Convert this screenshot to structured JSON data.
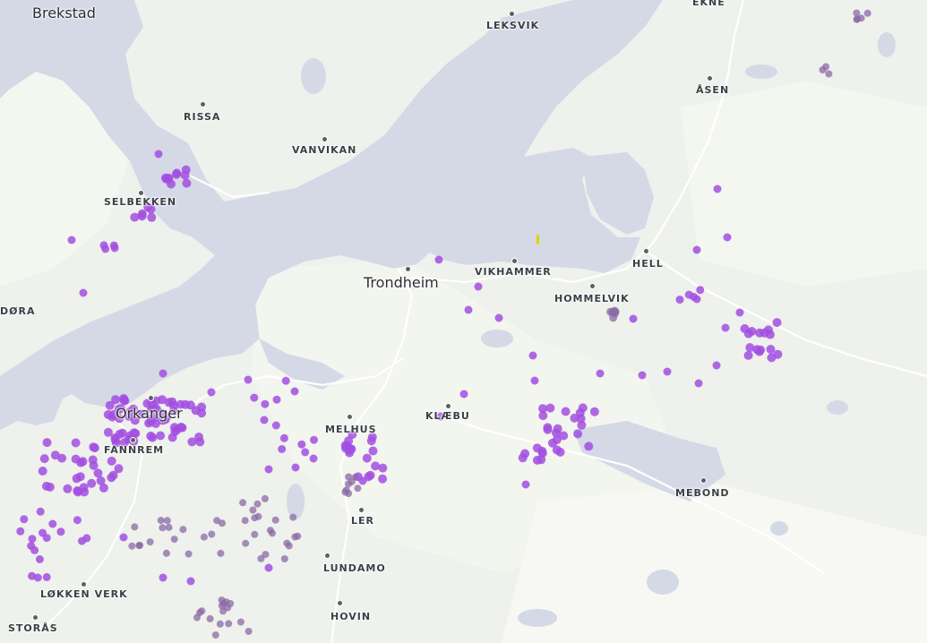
{
  "map": {
    "colors": {
      "land": "#eef1ec",
      "land_light": "#f6f8f2",
      "water": "#d5d9e6",
      "road": "#ffffff",
      "point_bright": "#a24fe0",
      "point_muted": "#8a6aa6",
      "marker_yellow": "#e2d400"
    },
    "labels": {
      "brekstad": "Brekstad",
      "leksvik": "LEKSVIK",
      "ekne": "EKNE",
      "asen": "ÅSEN",
      "rissa": "RISSA",
      "vanvikan": "VANVIKAN",
      "selbekken": "SELBEKKEN",
      "dora": "DØRA",
      "trondheim": "Trondheim",
      "vikhammer": "VIKHAMMER",
      "hell": "HELL",
      "hommelvik": "HOMMELVIK",
      "orkanger": "Orkanger",
      "fannrem": "FANNREM",
      "melhus": "MELHUS",
      "klaebu": "KLÆBU",
      "mebond": "MEBOND",
      "ler": "LER",
      "lundamo": "LUNDAMO",
      "lokken_verk": "LØKKEN VERK",
      "hovin": "HOVIN",
      "storas": "STORÅS"
    }
  }
}
